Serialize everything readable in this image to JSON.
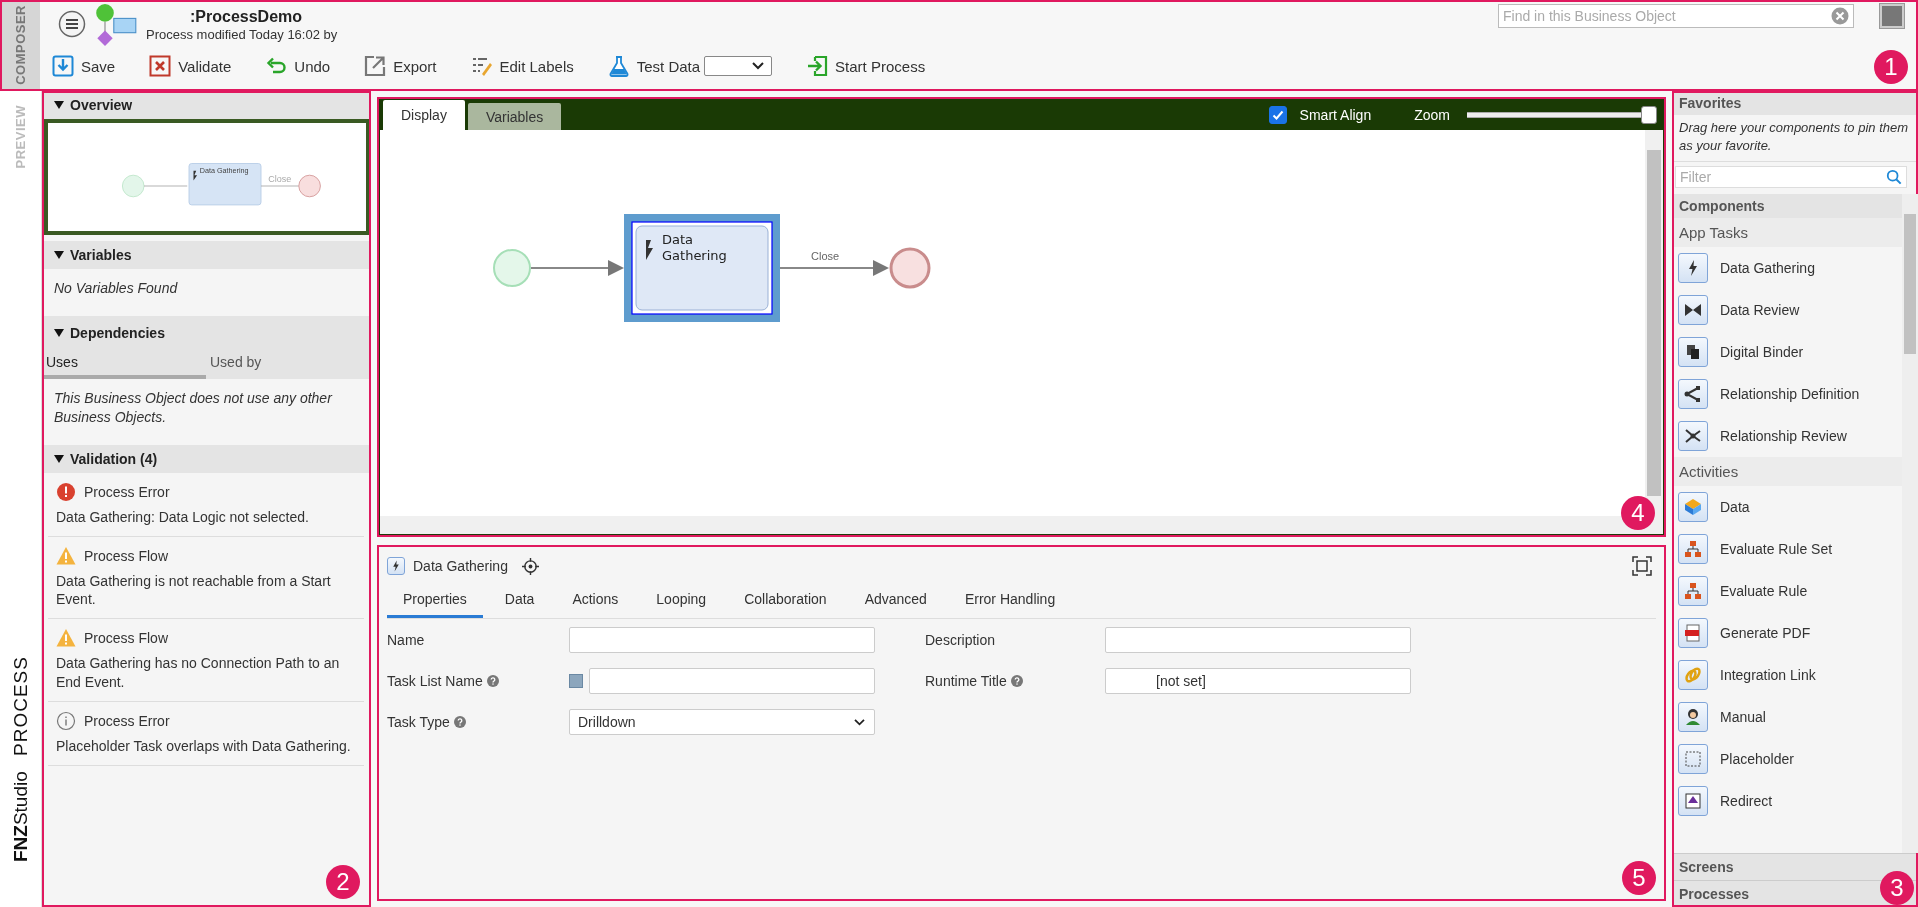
{
  "header": {
    "mode_tab": "COMPOSER",
    "title": ":ProcessDemo",
    "subtitle": "Process modified Today 16:02 by",
    "search": {
      "placeholder": "Find in this Business Object"
    },
    "callout": "1"
  },
  "toolbar": [
    {
      "label": "Save",
      "kind": "save"
    },
    {
      "label": "Validate",
      "kind": "validate"
    },
    {
      "label": "Undo",
      "kind": "undo"
    },
    {
      "label": "Export",
      "kind": "export"
    },
    {
      "label": "Edit Labels",
      "kind": "labels"
    },
    {
      "label": "Test Data",
      "kind": "testdata"
    },
    {
      "label": "Start Process",
      "kind": "start"
    }
  ],
  "side_strip": {
    "preview": "PREVIEW",
    "brand": "FNZ",
    "brand_suffix": "Studio",
    "product": "PROCESS"
  },
  "left_panel": {
    "callout": "2",
    "overview": {
      "title": "Overview",
      "expanded": true,
      "task_label": "Data Gathering",
      "edge_label": "Close"
    },
    "variables": {
      "title": "Variables",
      "expanded": true,
      "message": "No Variables Found"
    },
    "dependencies": {
      "title": "Dependencies",
      "expanded": true,
      "tabs": [
        {
          "label": "Uses",
          "selected": true
        },
        {
          "label": "Used by",
          "selected": false
        }
      ],
      "message": "This Business Object does not use any other Business Objects."
    },
    "validation": {
      "title": "Validation (4)",
      "expanded": true,
      "items": [
        {
          "kind": "error",
          "title": "Process Error",
          "message": "Data Gathering: Data Logic not selected."
        },
        {
          "kind": "warning",
          "title": "Process Flow",
          "message": "Data Gathering is not reachable from a Start Event."
        },
        {
          "kind": "warning",
          "title": "Process Flow",
          "message": "Data Gathering has no Connection Path to an End Event."
        },
        {
          "kind": "info",
          "title": "Process Error",
          "message": "Placeholder Task overlaps with Data Gathering."
        }
      ]
    }
  },
  "canvas": {
    "callout": "4",
    "tabs": [
      {
        "label": "Display",
        "selected": true
      },
      {
        "label": "Variables",
        "selected": false
      }
    ],
    "smart_align": {
      "label": "Smart Align",
      "checked": true
    },
    "zoom": {
      "label": "Zoom",
      "level": 1.0
    },
    "diagram": {
      "task_label": "Data Gathering",
      "edge_label": "Close",
      "task_selected": true
    }
  },
  "properties": {
    "callout": "5",
    "title": "Data Gathering",
    "tabs": [
      {
        "label": "Properties",
        "selected": true
      },
      {
        "label": "Data",
        "selected": false
      },
      {
        "label": "Actions",
        "selected": false
      },
      {
        "label": "Looping",
        "selected": false
      },
      {
        "label": "Collaboration",
        "selected": false
      },
      {
        "label": "Advanced",
        "selected": false
      },
      {
        "label": "Error Handling",
        "selected": false
      }
    ],
    "fields": [
      {
        "label": "Name",
        "help": false,
        "kind": "text"
      },
      {
        "label": "Description",
        "help": false,
        "kind": "text"
      },
      {
        "label": "Task List Name",
        "help": true,
        "kind": "expression"
      },
      {
        "label": "Runtime Title",
        "help": true,
        "kind": "text",
        "value": "[not set]"
      },
      {
        "label": "Task Type",
        "help": true,
        "kind": "select",
        "value": "Drilldown"
      }
    ]
  },
  "palette": {
    "callout": "3",
    "favorites": {
      "title": "Favorites",
      "hint": "Drag here your components to pin them as your favorite."
    },
    "filter": {
      "placeholder": "Filter"
    },
    "components_title": "Components",
    "groups": [
      {
        "title": "App Tasks",
        "items": [
          {
            "label": "Data Gathering",
            "kind": "bolt"
          },
          {
            "label": "Data Review",
            "kind": "bowtie"
          },
          {
            "label": "Digital Binder",
            "kind": "pages"
          },
          {
            "label": "Relationship Definition",
            "kind": "branch"
          },
          {
            "label": "Relationship Review",
            "kind": "network"
          }
        ]
      },
      {
        "title": "Activities",
        "items": [
          {
            "label": "Data",
            "kind": "cube"
          },
          {
            "label": "Evaluate Rule Set",
            "kind": "tree"
          },
          {
            "label": "Evaluate Rule",
            "kind": "tree"
          },
          {
            "label": "Generate PDF",
            "kind": "pdf"
          },
          {
            "label": "Integration Link",
            "kind": "link"
          },
          {
            "label": "Manual",
            "kind": "person"
          },
          {
            "label": "Placeholder",
            "kind": "dashed"
          },
          {
            "label": "Redirect",
            "kind": "redirect"
          }
        ]
      }
    ],
    "collapsed_sections": [
      {
        "title": "Screens"
      },
      {
        "title": "Processes"
      }
    ]
  }
}
